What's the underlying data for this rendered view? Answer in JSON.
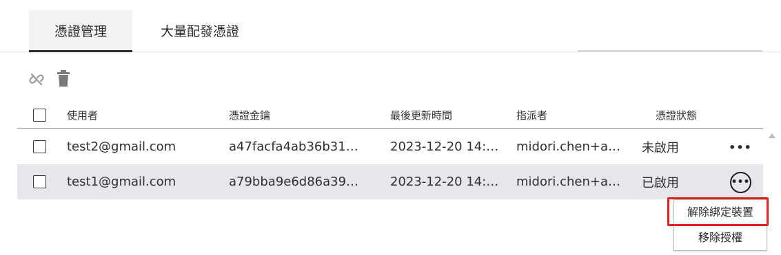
{
  "tabs": [
    {
      "label": "憑證管理",
      "active": true
    },
    {
      "label": "大量配發憑證",
      "active": false
    }
  ],
  "toolbar": {
    "unlink_icon": "unlink-icon",
    "delete_icon": "trash-icon"
  },
  "table": {
    "headers": {
      "user": "使用者",
      "key": "憑證金鑰",
      "updated": "最後更新時間",
      "assigner": "指派者",
      "status": "憑證狀態"
    },
    "rows": [
      {
        "user": "test2@gmail.com",
        "key": "a47facfa4ab36b31…",
        "updated": "2023-12-20 14:…",
        "assigner": "midori.chen+a…",
        "status": "未啟用",
        "more": "•••"
      },
      {
        "user": "test1@gmail.com",
        "key": "a79bba9e6d86a39…",
        "updated": "2023-12-20 14:…",
        "assigner": "midori.chen+a…",
        "status": "已啟用",
        "more": "•••"
      }
    ]
  },
  "context_menu": {
    "items": [
      "解除綁定裝置",
      "移除授權"
    ]
  },
  "colors": {
    "selected_row_bg": "#e5e7ed",
    "highlight_border": "#e0201b",
    "active_tab_bg": "#f2f2f2"
  }
}
